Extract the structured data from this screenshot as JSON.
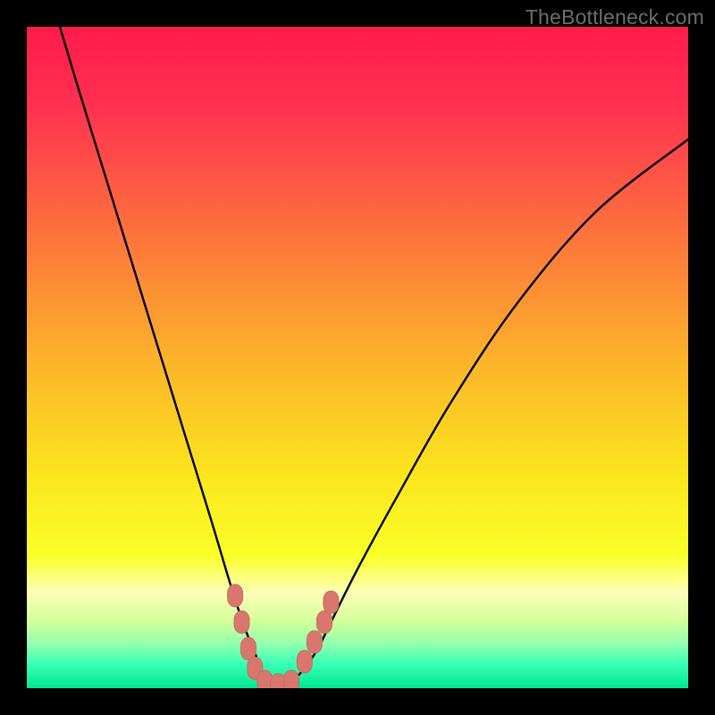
{
  "watermark": {
    "text": "TheBottleneck.com"
  },
  "colors": {
    "black": "#000000",
    "curve": "#000000",
    "marker_fill": "#d9776f",
    "marker_stroke": "#c96b63",
    "gradient_stops": [
      {
        "offset": 0.0,
        "color": "#ff1b4b"
      },
      {
        "offset": 0.12,
        "color": "#ff3150"
      },
      {
        "offset": 0.3,
        "color": "#fd6e3e"
      },
      {
        "offset": 0.5,
        "color": "#fcb22b"
      },
      {
        "offset": 0.68,
        "color": "#fbe61e"
      },
      {
        "offset": 0.8,
        "color": "#f9ff29"
      },
      {
        "offset": 0.855,
        "color": "#fdffb7"
      },
      {
        "offset": 0.9,
        "color": "#d2ff9a"
      },
      {
        "offset": 0.935,
        "color": "#8dffb0"
      },
      {
        "offset": 0.965,
        "color": "#35ffb3"
      },
      {
        "offset": 1.0,
        "color": "#00e792"
      }
    ]
  },
  "chart_data": {
    "type": "line",
    "title": "",
    "xlabel": "",
    "ylabel": "",
    "xlim": [
      0,
      100
    ],
    "ylim": [
      0,
      100
    ],
    "grid": false,
    "legend": false,
    "note": "V-shaped bottleneck curve. y represents bottleneck severity (0 = no bottleneck / green, 100 = severe / red). x is an unlabeled parameter. Minimum (~y=0) occurs around x≈36–40.",
    "series": [
      {
        "name": "bottleneck-curve",
        "x": [
          5,
          8,
          12,
          16,
          20,
          24,
          28,
          31,
          33,
          35,
          36,
          38,
          40,
          42,
          44,
          46,
          50,
          56,
          64,
          74,
          86,
          100
        ],
        "y": [
          100,
          90,
          77,
          64,
          51,
          38,
          25,
          15,
          9,
          4,
          1,
          0,
          1,
          3,
          6,
          10,
          18,
          29,
          43,
          58,
          72,
          83
        ]
      }
    ],
    "markers": {
      "name": "highlighted-points",
      "note": "Salmon rounded markers clustered near the valley floor on both arms.",
      "points": [
        {
          "x": 31.5,
          "y": 14
        },
        {
          "x": 32.5,
          "y": 10
        },
        {
          "x": 33.5,
          "y": 6
        },
        {
          "x": 34.5,
          "y": 3
        },
        {
          "x": 36.0,
          "y": 1
        },
        {
          "x": 38.0,
          "y": 0.5
        },
        {
          "x": 40.0,
          "y": 1
        },
        {
          "x": 42.0,
          "y": 4
        },
        {
          "x": 43.5,
          "y": 7
        },
        {
          "x": 45.0,
          "y": 10
        },
        {
          "x": 46.0,
          "y": 13
        }
      ]
    }
  }
}
